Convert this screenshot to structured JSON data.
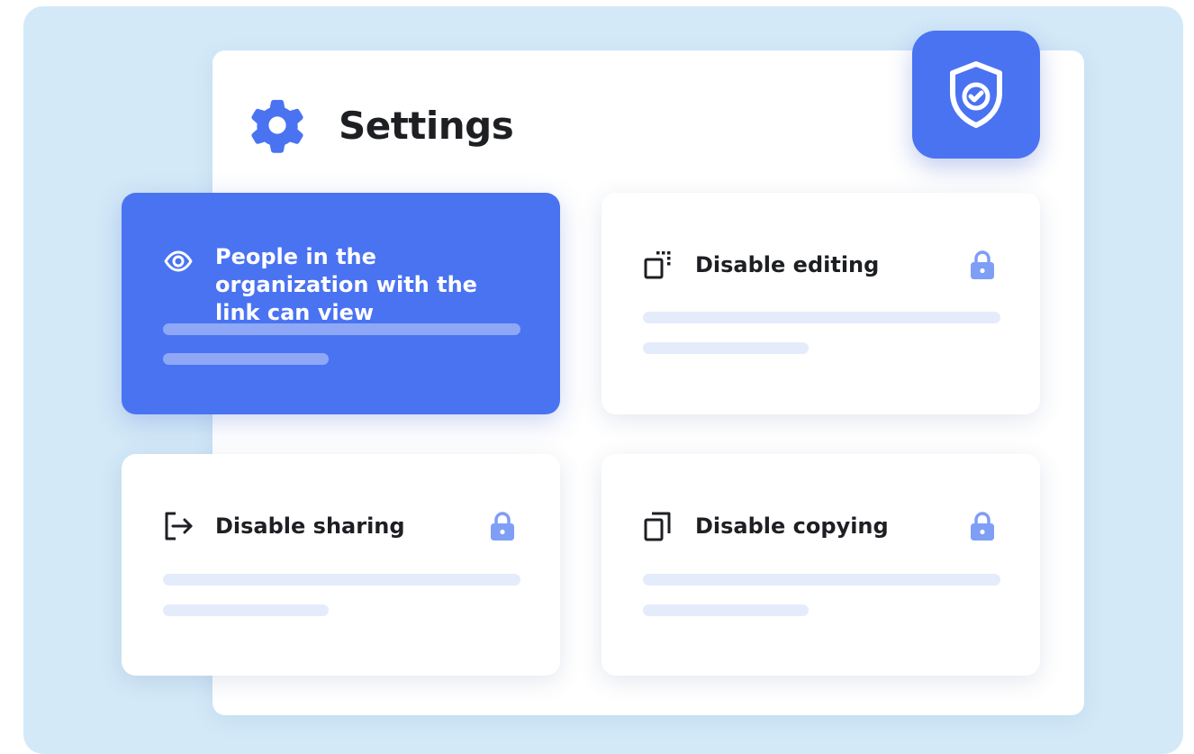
{
  "settings": {
    "title": "Settings"
  },
  "cards": [
    {
      "id": "org-link-view",
      "label": "People in the organization with the link can view",
      "icon": "eye-icon",
      "state": "selected",
      "locked": false
    },
    {
      "id": "disable-editing",
      "label": "Disable editing",
      "icon": "edit-selection-icon",
      "state": "default",
      "locked": true
    },
    {
      "id": "disable-sharing",
      "label": "Disable sharing",
      "icon": "share-exit-icon",
      "state": "default",
      "locked": true
    },
    {
      "id": "disable-copying",
      "label": "Disable copying",
      "icon": "copy-icon",
      "state": "default",
      "locked": true
    }
  ],
  "badge": {
    "icon": "shield-check-icon"
  },
  "colors": {
    "accent": "#4a73f2",
    "background": "#d3e9f8",
    "lock": "#7f9ef5",
    "placeholder": "#e4ebfb",
    "text": "#1e1f23"
  }
}
